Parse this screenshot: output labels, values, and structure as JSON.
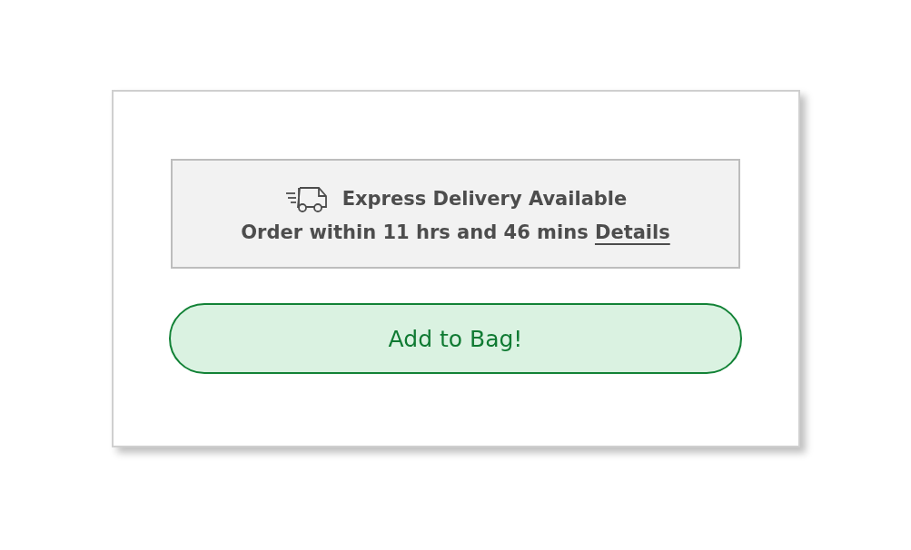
{
  "delivery": {
    "title": "Express Delivery Available",
    "deadline": "Order within 11 hrs and 46 mins",
    "link": "Details"
  },
  "add_button": {
    "label": "Add to Bag!"
  }
}
